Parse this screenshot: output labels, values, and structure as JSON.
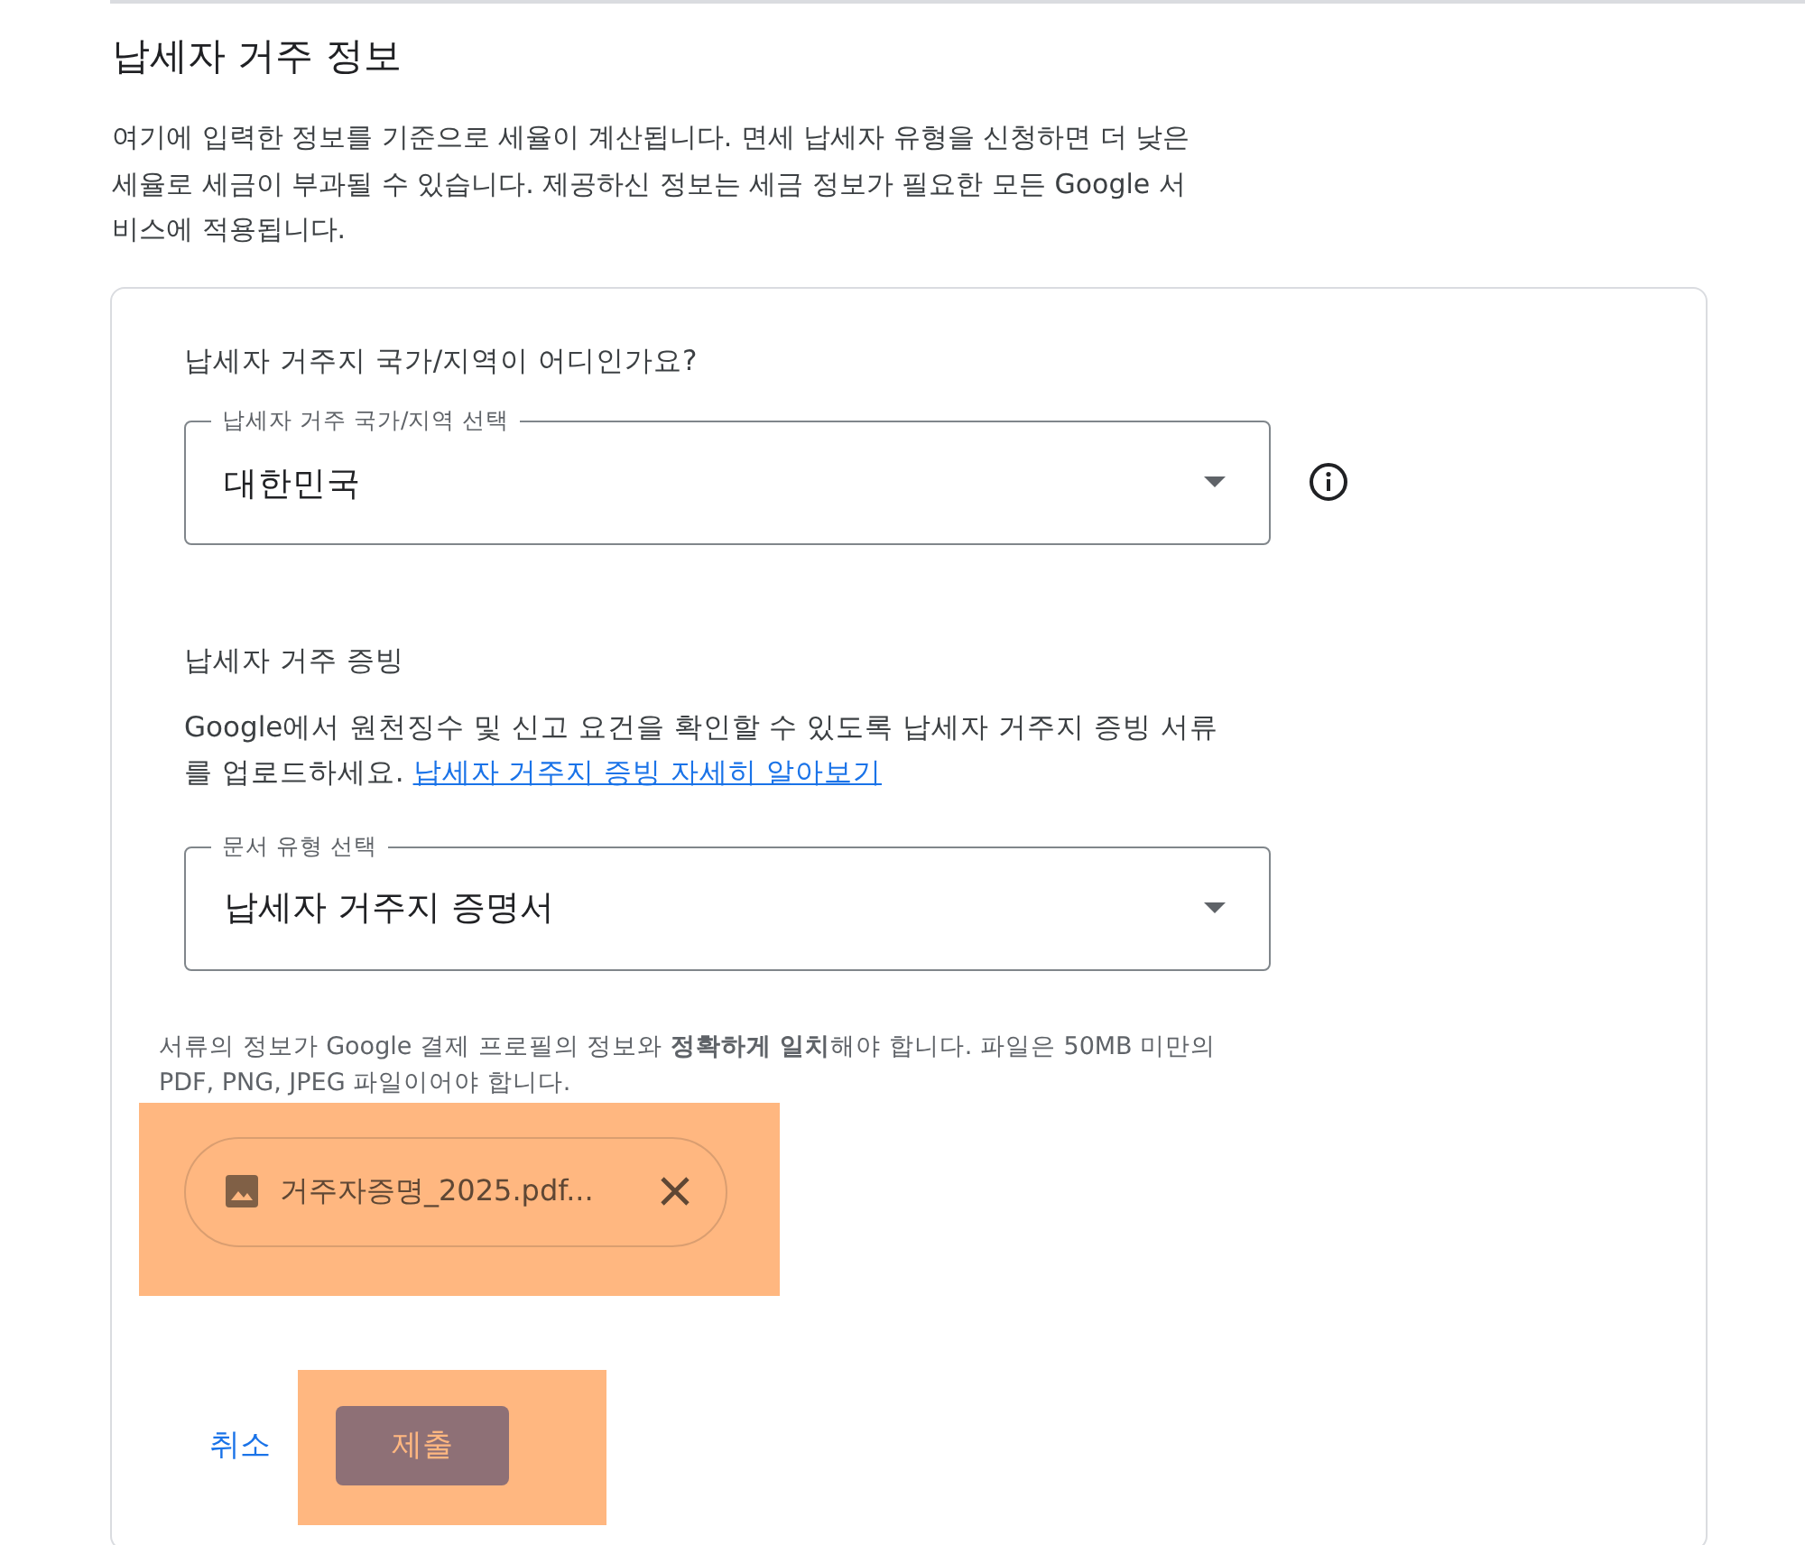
{
  "title": "납세자 거주 정보",
  "description": "여기에 입력한 정보를 기준으로 세율이 계산됩니다. 면세 납세자 유형을 신청하면 더 낮은 세율로 세금이 부과될 수 있습니다. 제공하신 정보는 세금 정보가 필요한 모든 Google 서비스에 적용됩니다.",
  "country": {
    "question": "납세자 거주지 국가/지역이 어디인가요?",
    "label": "납세자 거주 국가/지역 선택",
    "value": "대한민국"
  },
  "proof": {
    "heading": "납세자 거주 증빙",
    "text": "Google에서 원천징수 및 신고 요건을 확인할 수 있도록 납세자 거주지 증빙 서류를 업로드하세요.",
    "link": "납세자 거주지 증빙 자세히 알아보기"
  },
  "document": {
    "label": "문서 유형 선택",
    "value": "납세자 거주지 증명서"
  },
  "hint": "서류의 정보가 Google 결제 프로필의 정보와 **정확하게 일치**해야 합니다. 파일은 50MB 미만의 PDF, PNG, JPEG 파일이어야 합니다.",
  "file_chip": {
    "name": "거주자증명_2025.pdf..."
  },
  "buttons": {
    "cancel": "취소",
    "submit": "제출"
  }
}
